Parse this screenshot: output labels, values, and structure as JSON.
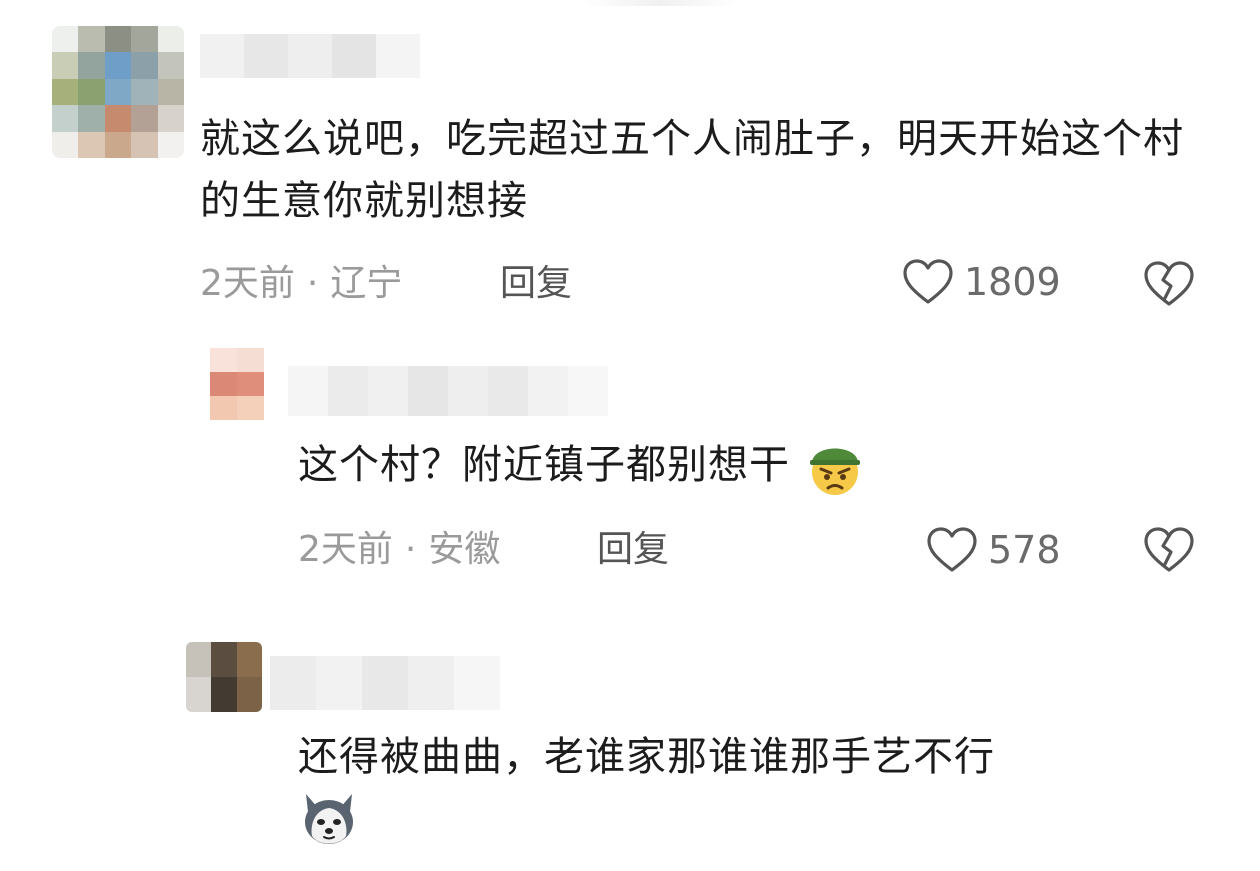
{
  "comments": [
    {
      "text": "就这么说吧，吃完超过五个人闹肚子，明天开始这个村的生意你就别想接",
      "time": "2天前",
      "location": "辽宁",
      "reply_label": "回复",
      "likes": "1809"
    },
    {
      "text": "这个村？附近镇子都别想干",
      "time": "2天前",
      "location": "安徽",
      "reply_label": "回复",
      "likes": "578",
      "emoji": "angry-soldier-emoji"
    },
    {
      "text": "还得被曲曲，老谁家那谁谁那手艺不行",
      "emoji": "husky-dog-emoji"
    }
  ],
  "icons": {
    "like": "heart-outline-icon",
    "dislike": "broken-heart-icon"
  },
  "colors": {
    "text": "#1c1c1c",
    "meta": "#9a9a9a",
    "icon": "#555555"
  }
}
